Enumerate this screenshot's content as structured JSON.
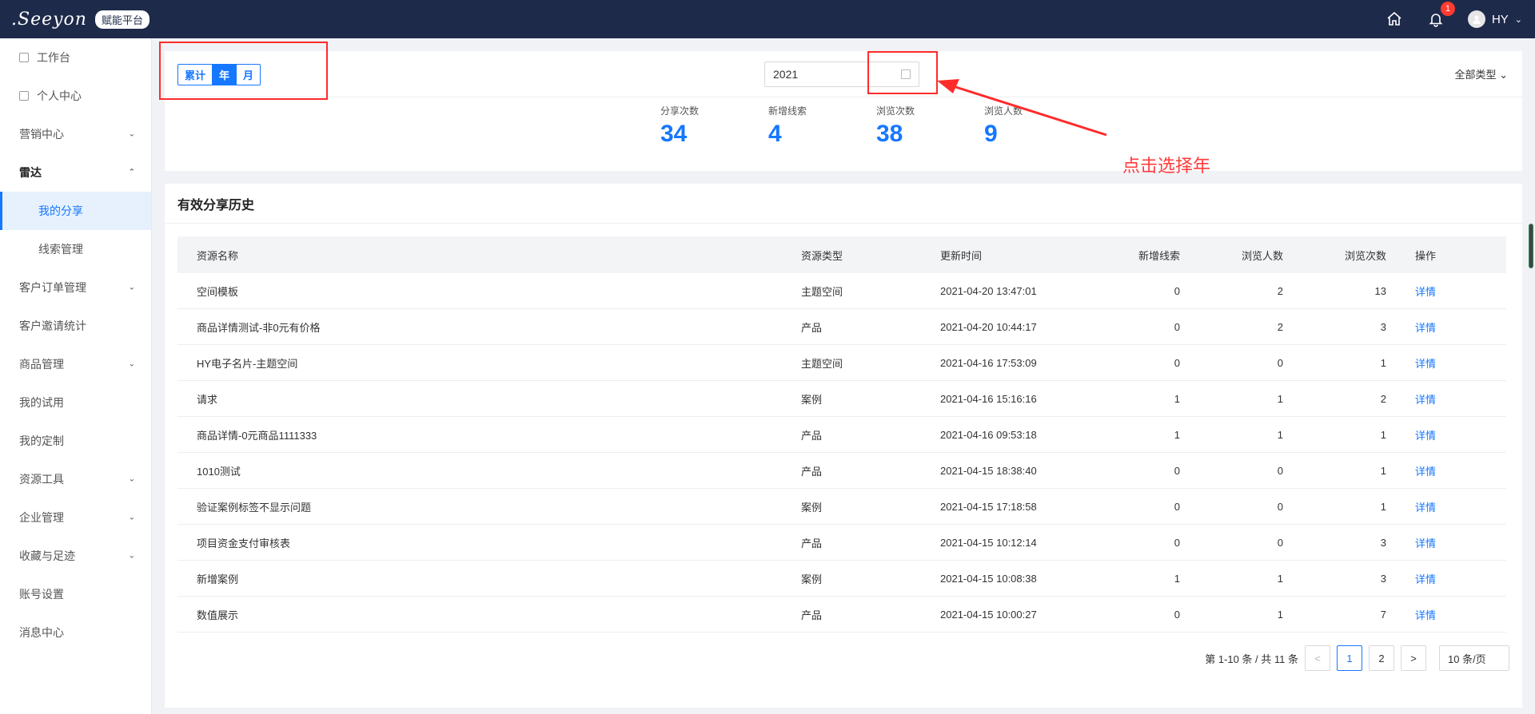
{
  "topbar": {
    "logo_text": ".Seeyon",
    "platform_label": "赋能平台",
    "notification_count": "1",
    "user_name": "HY"
  },
  "sidebar": {
    "items": [
      {
        "label": "工作台"
      },
      {
        "label": "个人中心"
      },
      {
        "label": "营销中心"
      },
      {
        "label": "雷达"
      },
      {
        "label": "我的分享"
      },
      {
        "label": "线索管理"
      },
      {
        "label": "客户订单管理"
      },
      {
        "label": "客户邀请统计"
      },
      {
        "label": "商品管理"
      },
      {
        "label": "我的试用"
      },
      {
        "label": "我的定制"
      },
      {
        "label": "资源工具"
      },
      {
        "label": "企业管理"
      },
      {
        "label": "收藏与足迹"
      },
      {
        "label": "账号设置"
      },
      {
        "label": "消息中心"
      }
    ]
  },
  "filter": {
    "segments": [
      "累计",
      "年",
      "月"
    ],
    "active_segment": "年",
    "year_value": "2021",
    "type_dropdown": "全部类型 ⌄"
  },
  "stats": [
    {
      "label": "分享次数",
      "value": "34"
    },
    {
      "label": "新增线索",
      "value": "4"
    },
    {
      "label": "浏览次数",
      "value": "38"
    },
    {
      "label": "浏览人数",
      "value": "9"
    }
  ],
  "annotation": {
    "text": "点击选择年"
  },
  "history": {
    "title": "有效分享历史",
    "columns": [
      "资源名称",
      "资源类型",
      "更新时间",
      "新增线索",
      "浏览人数",
      "浏览次数",
      "操作"
    ],
    "rows": [
      {
        "name": "空间模板",
        "type": "主题空间",
        "time": "2021-04-20 13:47:01",
        "leads": "0",
        "viewers": "2",
        "views": "13",
        "action": "详情"
      },
      {
        "name": "商品详情测试-非0元有价格",
        "type": "产品",
        "time": "2021-04-20 10:44:17",
        "leads": "0",
        "viewers": "2",
        "views": "3",
        "action": "详情"
      },
      {
        "name": "HY电子名片-主题空间",
        "type": "主题空间",
        "time": "2021-04-16 17:53:09",
        "leads": "0",
        "viewers": "0",
        "views": "1",
        "action": "详情"
      },
      {
        "name": "请求",
        "type": "案例",
        "time": "2021-04-16 15:16:16",
        "leads": "1",
        "viewers": "1",
        "views": "2",
        "action": "详情"
      },
      {
        "name": "商品详情-0元商品1111333",
        "type": "产品",
        "time": "2021-04-16 09:53:18",
        "leads": "1",
        "viewers": "1",
        "views": "1",
        "action": "详情"
      },
      {
        "name": "1010测试",
        "type": "产品",
        "time": "2021-04-15 18:38:40",
        "leads": "0",
        "viewers": "0",
        "views": "1",
        "action": "详情"
      },
      {
        "name": "验证案例标签不显示问题",
        "type": "案例",
        "time": "2021-04-15 17:18:58",
        "leads": "0",
        "viewers": "0",
        "views": "1",
        "action": "详情"
      },
      {
        "name": "项目资金支付审核表",
        "type": "产品",
        "time": "2021-04-15 10:12:14",
        "leads": "0",
        "viewers": "0",
        "views": "3",
        "action": "详情"
      },
      {
        "name": "新增案例",
        "type": "案例",
        "time": "2021-04-15 10:08:38",
        "leads": "1",
        "viewers": "1",
        "views": "3",
        "action": "详情"
      },
      {
        "name": "数值展示",
        "type": "产品",
        "time": "2021-04-15 10:00:27",
        "leads": "0",
        "viewers": "1",
        "views": "7",
        "action": "详情"
      }
    ]
  },
  "pagination": {
    "summary": "第 1-10 条 / 共 11 条",
    "prev": "<",
    "pages": [
      "1",
      "2"
    ],
    "next": ">",
    "page_size": "10 条/页"
  }
}
